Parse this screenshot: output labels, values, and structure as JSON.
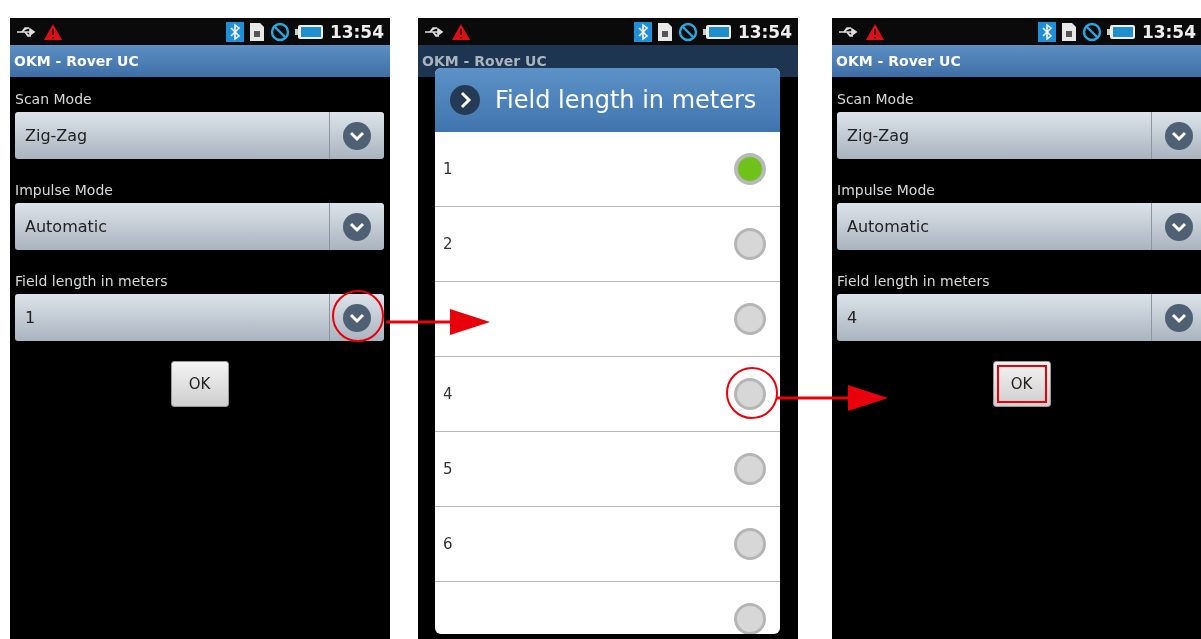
{
  "screens": [
    {
      "kind": "form",
      "dimmed": false,
      "status_bar": {
        "time": "13:54"
      },
      "title": "OKM - Rover UC",
      "fields": [
        {
          "label": "Scan Mode",
          "value": "Zig-Zag",
          "highlighted": false
        },
        {
          "label": "Impulse Mode",
          "value": "Automatic",
          "highlighted": false
        },
        {
          "label": "Field length in meters",
          "value": "1",
          "highlighted": true
        }
      ],
      "ok_button": {
        "label": "OK",
        "highlighted": false
      }
    },
    {
      "kind": "dialog",
      "dimmed": true,
      "status_bar": {
        "time": "13:54"
      },
      "title": "OKM - Rover UC",
      "dialog": {
        "title": "Field length in meters",
        "options": [
          {
            "label": "1",
            "selected": true,
            "highlighted": false
          },
          {
            "label": "2",
            "selected": false,
            "highlighted": false
          },
          {
            "selected": false,
            "highlighted": false
          },
          {
            "label": "4",
            "selected": false,
            "highlighted": true
          },
          {
            "label": "5",
            "selected": false,
            "highlighted": false
          },
          {
            "label": "6",
            "selected": false,
            "highlighted": false
          },
          {
            "selected": false,
            "highlighted": false
          }
        ]
      }
    },
    {
      "kind": "form",
      "dimmed": false,
      "status_bar": {
        "time": "13:54"
      },
      "title": "OKM - Rover UC",
      "fields": [
        {
          "label": "Scan Mode",
          "value": "Zig-Zag",
          "highlighted": false
        },
        {
          "label": "Impulse Mode",
          "value": "Automatic",
          "highlighted": false
        },
        {
          "label": "Field length in meters",
          "value": "4",
          "highlighted": false
        }
      ],
      "ok_button": {
        "label": "OK",
        "highlighted": true
      }
    }
  ],
  "arrows": [
    {
      "kind": "right"
    },
    {
      "kind": "right"
    }
  ]
}
